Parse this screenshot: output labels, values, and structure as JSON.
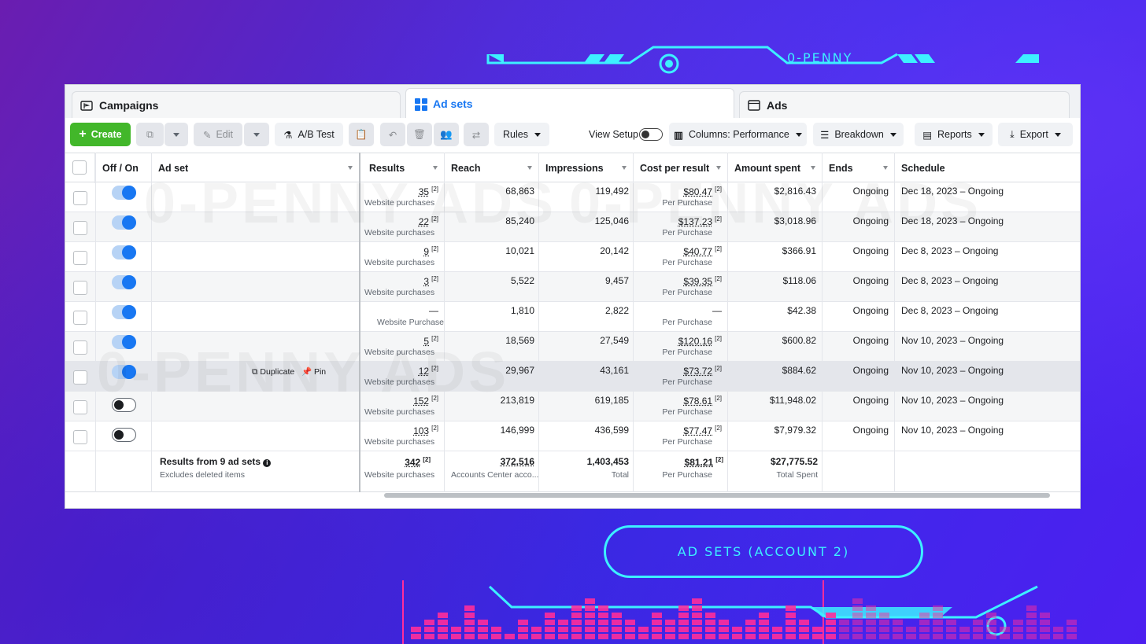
{
  "brand": "0-PENNY",
  "banner": "AD SETS (ACCOUNT 2)",
  "watermark": "0-PENNY ADS",
  "tabs": [
    {
      "label": "Campaigns"
    },
    {
      "label": "Ad sets"
    },
    {
      "label": "Ads"
    }
  ],
  "toolbar": {
    "create": "Create",
    "edit": "Edit",
    "ab_test": "A/B Test",
    "rules": "Rules",
    "view_setup": "View Setup",
    "columns": "Columns: Performance",
    "breakdown": "Breakdown",
    "reports": "Reports",
    "export": "Export"
  },
  "columns": [
    "Off / On",
    "Ad set",
    "Results",
    "Reach",
    "Impressions",
    "Cost per result",
    "Amount spent",
    "Ends",
    "Schedule"
  ],
  "rows": [
    {
      "on": true,
      "results": "35",
      "results_sub": "Website purchases",
      "reach": "68,863",
      "impressions": "119,492",
      "cpr": "$80.47",
      "cpr_sub": "Per Purchase",
      "spent": "$2,816.43",
      "ends": "Ongoing",
      "schedule": "Dec 18, 2023 – Ongoing"
    },
    {
      "on": true,
      "results": "22",
      "results_sub": "Website purchases",
      "reach": "85,240",
      "impressions": "125,046",
      "cpr": "$137.23",
      "cpr_sub": "Per Purchase",
      "spent": "$3,018.96",
      "ends": "Ongoing",
      "schedule": "Dec 18, 2023 – Ongoing"
    },
    {
      "on": true,
      "results": "9",
      "results_sub": "Website purchases",
      "reach": "10,021",
      "impressions": "20,142",
      "cpr": "$40.77",
      "cpr_sub": "Per Purchase",
      "spent": "$366.91",
      "ends": "Ongoing",
      "schedule": "Dec 8, 2023 – Ongoing"
    },
    {
      "on": true,
      "results": "3",
      "results_sub": "Website purchases",
      "reach": "5,522",
      "impressions": "9,457",
      "cpr": "$39.35",
      "cpr_sub": "Per Purchase",
      "spent": "$118.06",
      "ends": "Ongoing",
      "schedule": "Dec 8, 2023 – Ongoing"
    },
    {
      "on": true,
      "results": "—",
      "results_sub": "Website Purchase",
      "reach": "1,810",
      "impressions": "2,822",
      "cpr": "—",
      "cpr_sub": "Per Purchase",
      "spent": "$42.38",
      "ends": "Ongoing",
      "schedule": "Dec 8, 2023 – Ongoing"
    },
    {
      "on": true,
      "results": "5",
      "results_sub": "Website purchases",
      "reach": "18,569",
      "impressions": "27,549",
      "cpr": "$120.16",
      "cpr_sub": "Per Purchase",
      "spent": "$600.82",
      "ends": "Ongoing",
      "schedule": "Nov 10, 2023 – Ongoing"
    },
    {
      "on": true,
      "results": "12",
      "results_sub": "Website purchases",
      "reach": "29,967",
      "impressions": "43,161",
      "cpr": "$73.72",
      "cpr_sub": "Per Purchase",
      "spent": "$884.62",
      "ends": "Ongoing",
      "schedule": "Nov 10, 2023 – Ongoing"
    },
    {
      "on": false,
      "results": "152",
      "results_sub": "Website purchases",
      "reach": "213,819",
      "impressions": "619,185",
      "cpr": "$78.61",
      "cpr_sub": "Per Purchase",
      "spent": "$11,948.02",
      "ends": "Ongoing",
      "schedule": "Nov 10, 2023 – Ongoing"
    },
    {
      "on": false,
      "results": "103",
      "results_sub": "Website purchases",
      "reach": "146,999",
      "impressions": "436,599",
      "cpr": "$77.47",
      "cpr_sub": "Per Purchase",
      "spent": "$7,979.32",
      "ends": "Ongoing",
      "schedule": "Nov 10, 2023 – Ongoing"
    }
  ],
  "row_actions": {
    "duplicate": "Duplicate",
    "pin": "Pin"
  },
  "footnote_mark": "[2]",
  "totals": {
    "label": "Results from 9 ad sets",
    "sub": "Excludes deleted items",
    "results": "342",
    "results_sub": "Website purchases",
    "reach": "372,516",
    "reach_sub": "Accounts Center acco...",
    "impressions": "1,403,453",
    "impressions_sub": "Total",
    "cpr": "$81.21",
    "cpr_sub": "Per Purchase",
    "spent": "$27,775.52",
    "spent_sub": "Total Spent"
  },
  "colors": {
    "accent": "#1877f2",
    "create": "#42b72a",
    "neon": "#3df0ff",
    "eq": "#ff2d9b"
  }
}
